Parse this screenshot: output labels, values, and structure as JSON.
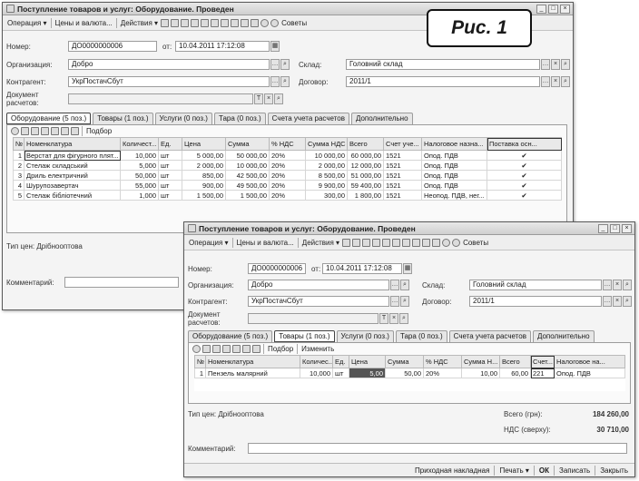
{
  "figure_label": "Рис. 1",
  "w1": {
    "title": "Поступление товаров и услуг: Оборудование. Проведен",
    "toolbar": {
      "operation": "Операция ▾",
      "prices": "Цены и валюта...",
      "actions": "Действия ▾",
      "advice": "Советы"
    },
    "labels": {
      "number": "Номер:",
      "from": "от:",
      "org": "Организация:",
      "warehouse": "Склад:",
      "contractor": "Контрагент:",
      "contract": "Договор:",
      "doc1": "Документ",
      "doc2": "расчетов:",
      "price_type": "Тип цен: Дрібнооптова",
      "comment": "Комментарий:"
    },
    "values": {
      "number": "ДО0000000006",
      "date": "10.04.2011 17:12:08",
      "org": "Добро",
      "warehouse": "Головний склад",
      "contractor": "УкрПостачСбут",
      "contract": "2011/1"
    },
    "tabs": [
      "Оборудование (5 поз.)",
      "Товары (1 поз.)",
      "Услуги (0 поз.)",
      "Тара (0 поз.)",
      "Счета учета расчетов",
      "Дополнительно"
    ],
    "table_tool": "Подбор",
    "columns": [
      "№",
      "Номенклатура",
      "Количест...",
      "Ед.",
      "Цена",
      "Сумма",
      "% НДС",
      "Сумма НДС",
      "Всего",
      "Счет уче...",
      "Налоговое назна...",
      "Поставка осн..."
    ],
    "rows": [
      [
        "1",
        "Верстат для фігурного плят...",
        "10,000",
        "шт",
        "5 000,00",
        "50 000,00",
        "20%",
        "10 000,00",
        "60 000,00",
        "1521",
        "Опод. ПДВ",
        "✔"
      ],
      [
        "2",
        "Стелаж складський",
        "5,000",
        "шт",
        "2 000,00",
        "10 000,00",
        "20%",
        "2 000,00",
        "12 000,00",
        "1521",
        "Опод. ПДВ",
        "✔"
      ],
      [
        "3",
        "Дриль електричний",
        "50,000",
        "шт",
        "850,00",
        "42 500,00",
        "20%",
        "8 500,00",
        "51 000,00",
        "1521",
        "Опод. ПДВ",
        "✔"
      ],
      [
        "4",
        "Шурупозавертач",
        "55,000",
        "шт",
        "900,00",
        "49 500,00",
        "20%",
        "9 900,00",
        "59 400,00",
        "1521",
        "Опод. ПДВ",
        "✔"
      ],
      [
        "5",
        "Стелаж бібліотечний",
        "1,000",
        "шт",
        "1 500,00",
        "1 500,00",
        "20%",
        "300,00",
        "1 800,00",
        "1521",
        "Неопод. ПДВ, нег...",
        "✔"
      ]
    ]
  },
  "w2": {
    "title": "Поступление товаров и услуг: Оборудование. Проведен",
    "toolbar": {
      "operation": "Операция ▾",
      "prices": "Цены и валюта...",
      "actions": "Действия ▾",
      "advice": "Советы"
    },
    "labels": {
      "number": "Номер:",
      "from": "от:",
      "org": "Организация:",
      "warehouse": "Склад:",
      "contractor": "Контрагент:",
      "contract": "Договор:",
      "doc1": "Документ",
      "doc2": "расчетов:",
      "price_type": "Тип цен: Дрібнооптова",
      "comment": "Комментарий:",
      "total_label": "Всего (грн):",
      "vat_label": "НДС (сверху):"
    },
    "values": {
      "number": "ДО0000000006",
      "date": "10.04.2011 17:12:08",
      "org": "Добро",
      "warehouse": "Головний склад",
      "contractor": "УкрПостачСбут",
      "contract": "2011/1",
      "total": "184 260,00",
      "vat": "30 710,00"
    },
    "tabs": [
      "Оборудование (5 поз.)",
      "Товары (1 поз.)",
      "Услуги (0 поз.)",
      "Тара (0 поз.)",
      "Счета учета расчетов",
      "Дополнительно"
    ],
    "table_tool": "Подбор",
    "table_tool2": "Изменить",
    "columns": [
      "№",
      "Номенклатура",
      "Количес...",
      "Ед.",
      "Цена",
      "Сумма",
      "% НДС",
      "Сумма Н...",
      "Всего",
      "Счет...",
      "Налоговое на..."
    ],
    "rows": [
      [
        "1",
        "Пензель малярний",
        "10,000",
        "шт",
        "5,00",
        "50,00",
        "20%",
        "10,00",
        "60,00",
        "221",
        "Опод. ПДВ"
      ]
    ],
    "footer": [
      "Приходная накладная",
      "Печать ▾",
      "ОК",
      "Записать",
      "Закрыть"
    ]
  }
}
